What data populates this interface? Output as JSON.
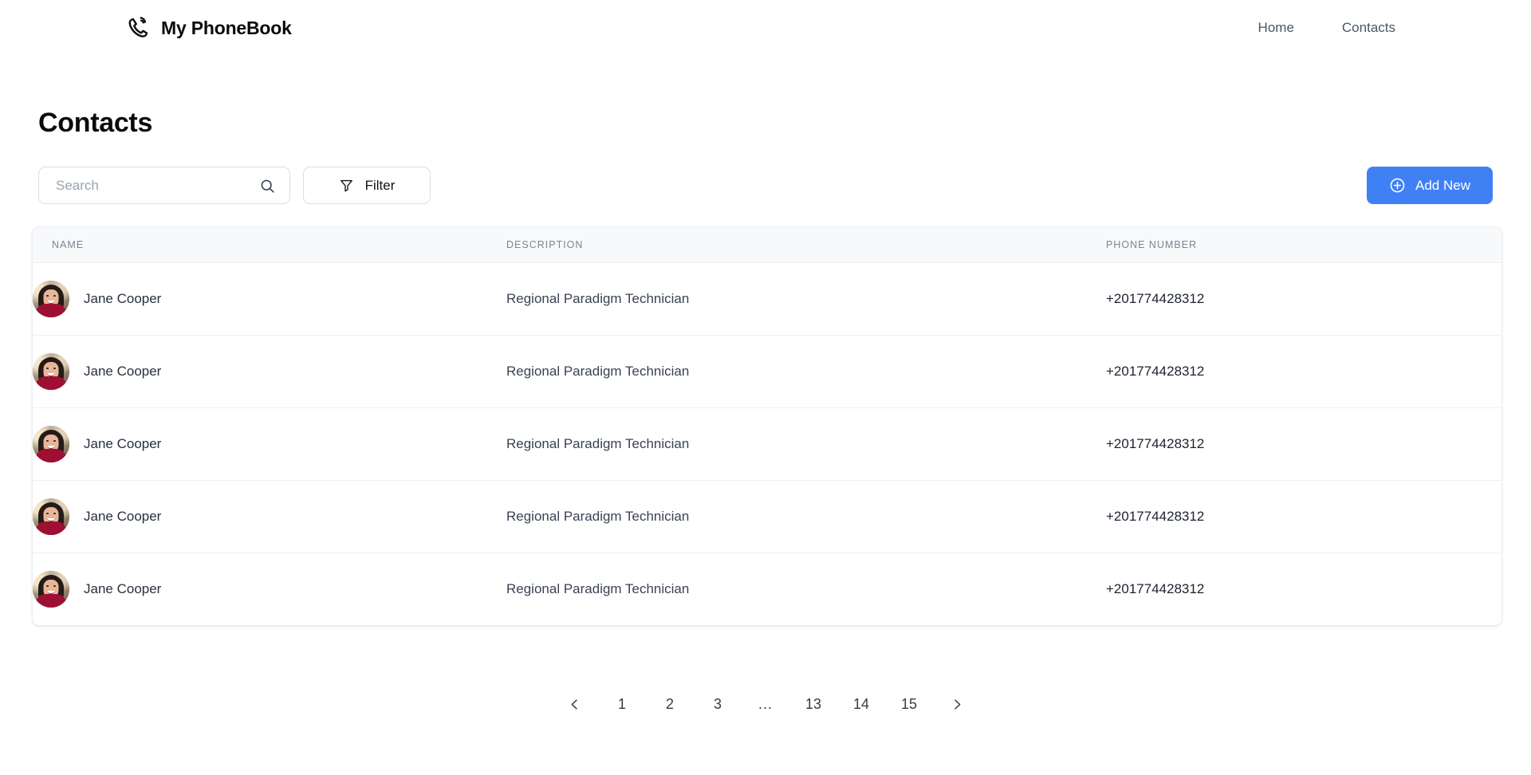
{
  "app": {
    "brand_name": "My PhoneBook",
    "brand_icon": "phone-call-icon"
  },
  "nav": {
    "links": [
      {
        "label": "Home"
      },
      {
        "label": "Contacts"
      }
    ]
  },
  "page": {
    "title": "Contacts"
  },
  "toolbar": {
    "search_placeholder": "Search",
    "search_value": "",
    "search_icon": "search-icon",
    "filter_label": "Filter",
    "filter_icon": "funnel-icon",
    "add_label": "Add New",
    "add_icon": "plus-circle-icon",
    "add_color": "#4080f5"
  },
  "table": {
    "columns": [
      "NAME",
      "DESCRIPTION",
      "PHONE NUMBER"
    ],
    "rows": [
      {
        "name": "Jane Cooper",
        "description": "Regional Paradigm Technician",
        "phone": "+201774428312",
        "avatar": "woman-avatar"
      },
      {
        "name": "Jane Cooper",
        "description": "Regional Paradigm Technician",
        "phone": "+201774428312",
        "avatar": "woman-avatar"
      },
      {
        "name": "Jane Cooper",
        "description": "Regional Paradigm Technician",
        "phone": "+201774428312",
        "avatar": "woman-avatar"
      },
      {
        "name": "Jane Cooper",
        "description": "Regional Paradigm Technician",
        "phone": "+201774428312",
        "avatar": "woman-avatar"
      },
      {
        "name": "Jane Cooper",
        "description": "Regional Paradigm Technician",
        "phone": "+201774428312",
        "avatar": "woman-avatar"
      }
    ]
  },
  "pagination": {
    "prev_icon": "chevron-left-icon",
    "next_icon": "chevron-right-icon",
    "pages": [
      "1",
      "2",
      "3",
      "...",
      "13",
      "14",
      "15"
    ]
  }
}
